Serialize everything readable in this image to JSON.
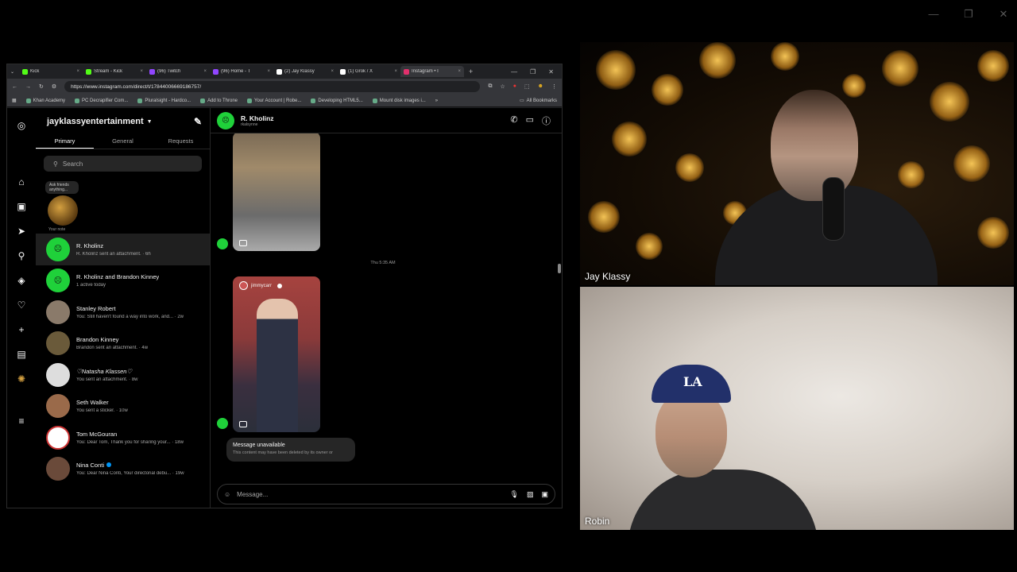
{
  "window_controls": [
    "—",
    "❐",
    "✕"
  ],
  "browser": {
    "tabs": [
      {
        "label": "Kick",
        "color": "#53fc18"
      },
      {
        "label": "Stream - Kick",
        "color": "#53fc18"
      },
      {
        "label": "(96) Twitch",
        "color": "#9146ff"
      },
      {
        "label": "(96) Home - T",
        "color": "#9146ff"
      },
      {
        "label": "(2) Jay Klassy",
        "color": "#ffffff"
      },
      {
        "label": "(1) Grok / X",
        "color": "#ffffff"
      },
      {
        "label": "Instagram • I",
        "color": "#e1306c"
      }
    ],
    "url": "https://www.instagram.com/direct/t/17844006669186757/",
    "bookmarks": [
      "Khan Academy",
      "PC Decrapifier Com...",
      "Pluralsight - Hardco...",
      "Add to Throne",
      "Your Account | Robe...",
      "Developing HTML5...",
      "Mount disk images i..."
    ],
    "all_bookmarks": "All Bookmarks"
  },
  "instagram": {
    "account": "jayklassyentertainment",
    "list_tabs": [
      "Primary",
      "General",
      "Requests"
    ],
    "search_placeholder": "Search",
    "note_bubble": "Ask friends anything...",
    "note_caption": "Your note",
    "conversations": [
      {
        "name": "R. Kholinz",
        "preview": "R. Kholinz sent an attachment. · 6h",
        "avatar_color": "#1fd13a",
        "selected": true
      },
      {
        "name": "R. Kholinz and Brandon Kinney",
        "preview": "1 active today",
        "avatar_color": "#1fd13a"
      },
      {
        "name": "Stanley Robert",
        "preview": "You: Still haven't found a way into work, and... · 2w",
        "avatar_color": "#8a7a6a"
      },
      {
        "name": "Brandon Kinney",
        "preview": "Brandon sent an attachment. · 4w",
        "avatar_color": "#6a5a3a"
      },
      {
        "name": "♡Natasha Klassen♡",
        "preview": "You sent an attachment. · 8w",
        "avatar_color": "#dddddd"
      },
      {
        "name": "Seth Walker",
        "preview": "You sent a sticker. · 10w",
        "avatar_color": "#9a6a4a"
      },
      {
        "name": "Tom McGouran",
        "preview": "You: Dear Tom, Thank you for sharing your... · 18w",
        "avatar_color": "#ffffff"
      },
      {
        "name": "Nina Conti",
        "preview": "You: Dear Nina Conti, Your directorial debu... · 19w",
        "avatar_color": "#6a4a3a",
        "verified": true
      }
    ],
    "chat": {
      "name": "R. Kholinz",
      "username": "rkalsynne",
      "timestamp": "Thu 5:35 AM",
      "reel_account": "jimmycarr",
      "unavailable_title": "Message unavailable",
      "unavailable_text": "This content may have been deleted by its owner or",
      "composer_placeholder": "Message..."
    }
  },
  "cams": {
    "top_label": "Jay Klassy",
    "bottom_label": "Robin",
    "cap_text": "LA"
  }
}
